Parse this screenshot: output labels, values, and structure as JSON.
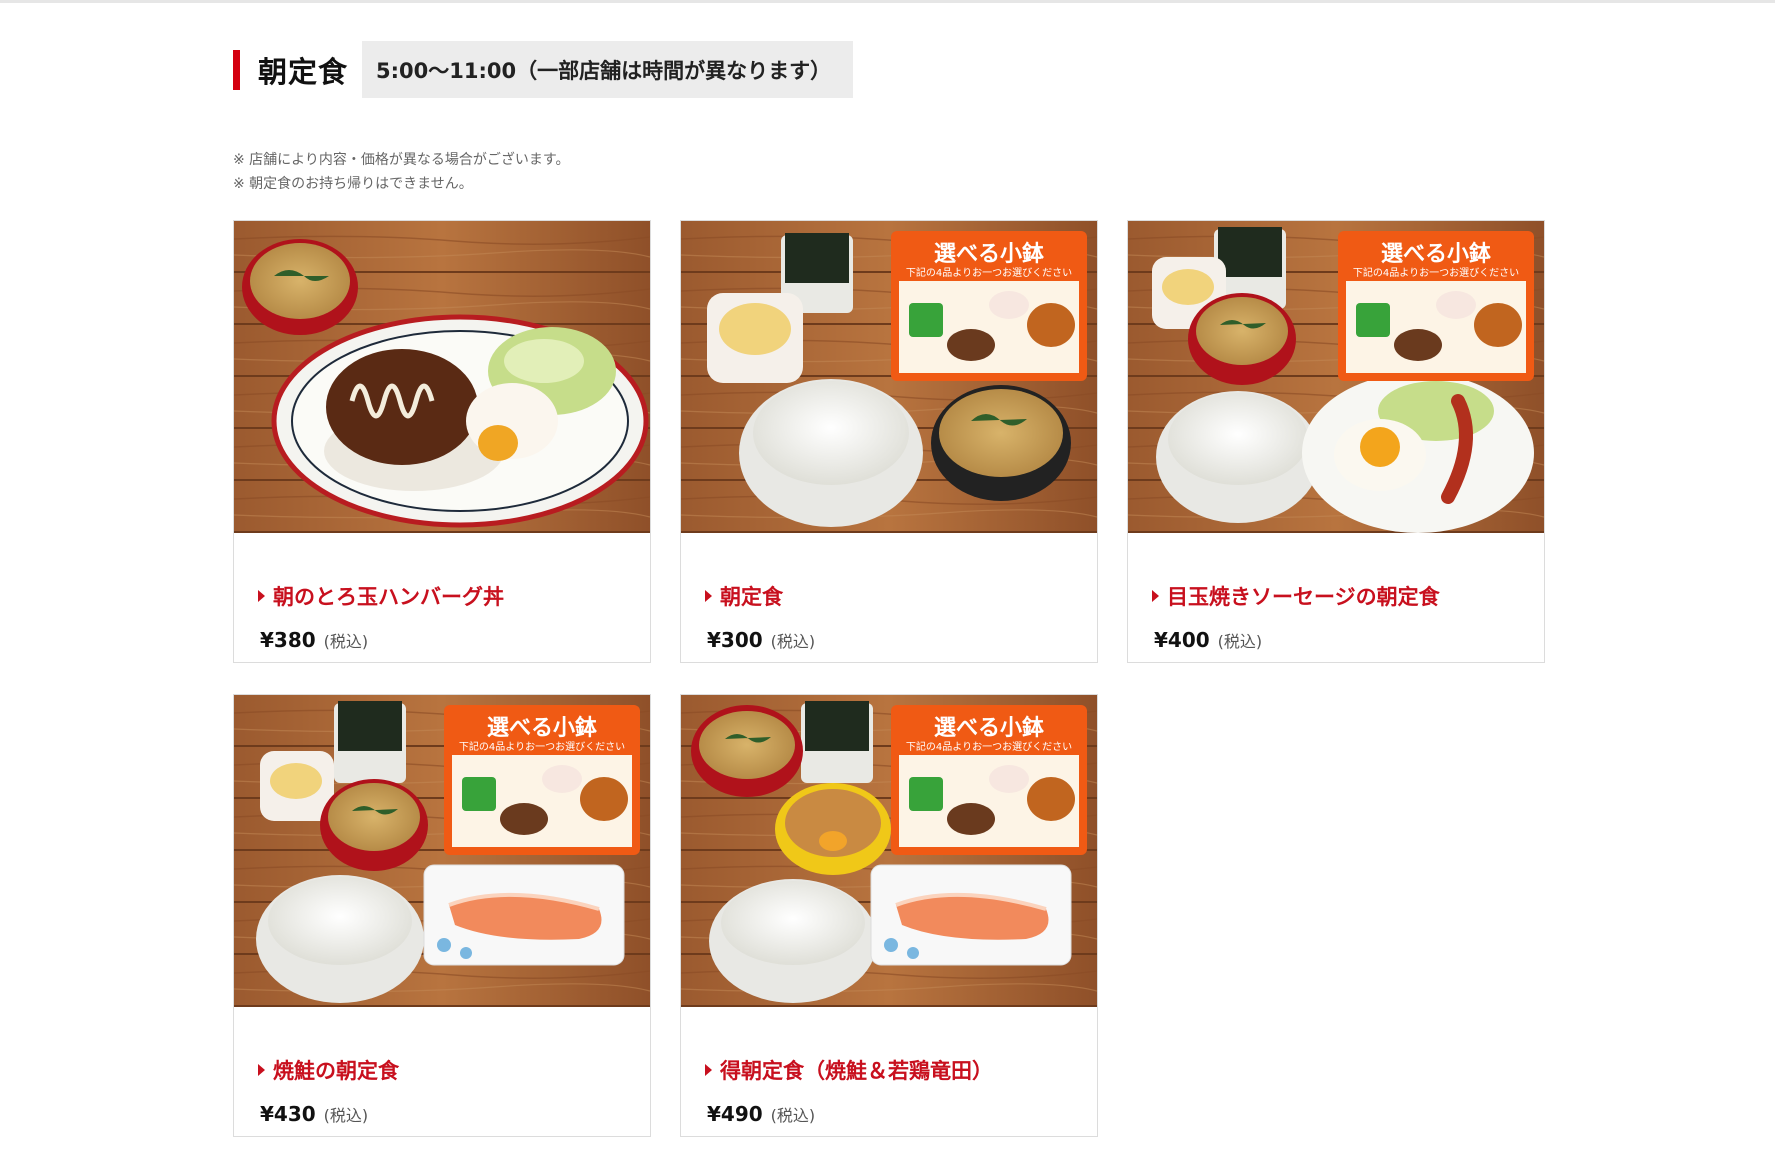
{
  "section": {
    "title": "朝定食",
    "hours": "5:00～11:00（一部店舗は時間が異なります）",
    "notes": [
      "※ 店舗により内容・価格が異なる場合がございます。",
      "※ 朝定食のお持ち帰りはできません。"
    ]
  },
  "badge": {
    "title": "選べる小鉢",
    "subtitle": "下記の4品よりお一つお選びください"
  },
  "items": [
    {
      "name": "朝のとろ玉ハンバーグ丼",
      "price": "¥380",
      "tax": "(税込)"
    },
    {
      "name": "朝定食",
      "price": "¥300",
      "tax": "(税込)"
    },
    {
      "name": "目玉焼きソーセージの朝定食",
      "price": "¥400",
      "tax": "(税込)"
    },
    {
      "name": "焼鮭の朝定食",
      "price": "¥430",
      "tax": "(税込)"
    },
    {
      "name": "得朝定食（焼鮭＆若鶏竜田）",
      "price": "¥490",
      "tax": "(税込)"
    }
  ],
  "colors": {
    "accent": "#c8101e",
    "badge": "#f05a14",
    "wood": "#a8673a"
  }
}
